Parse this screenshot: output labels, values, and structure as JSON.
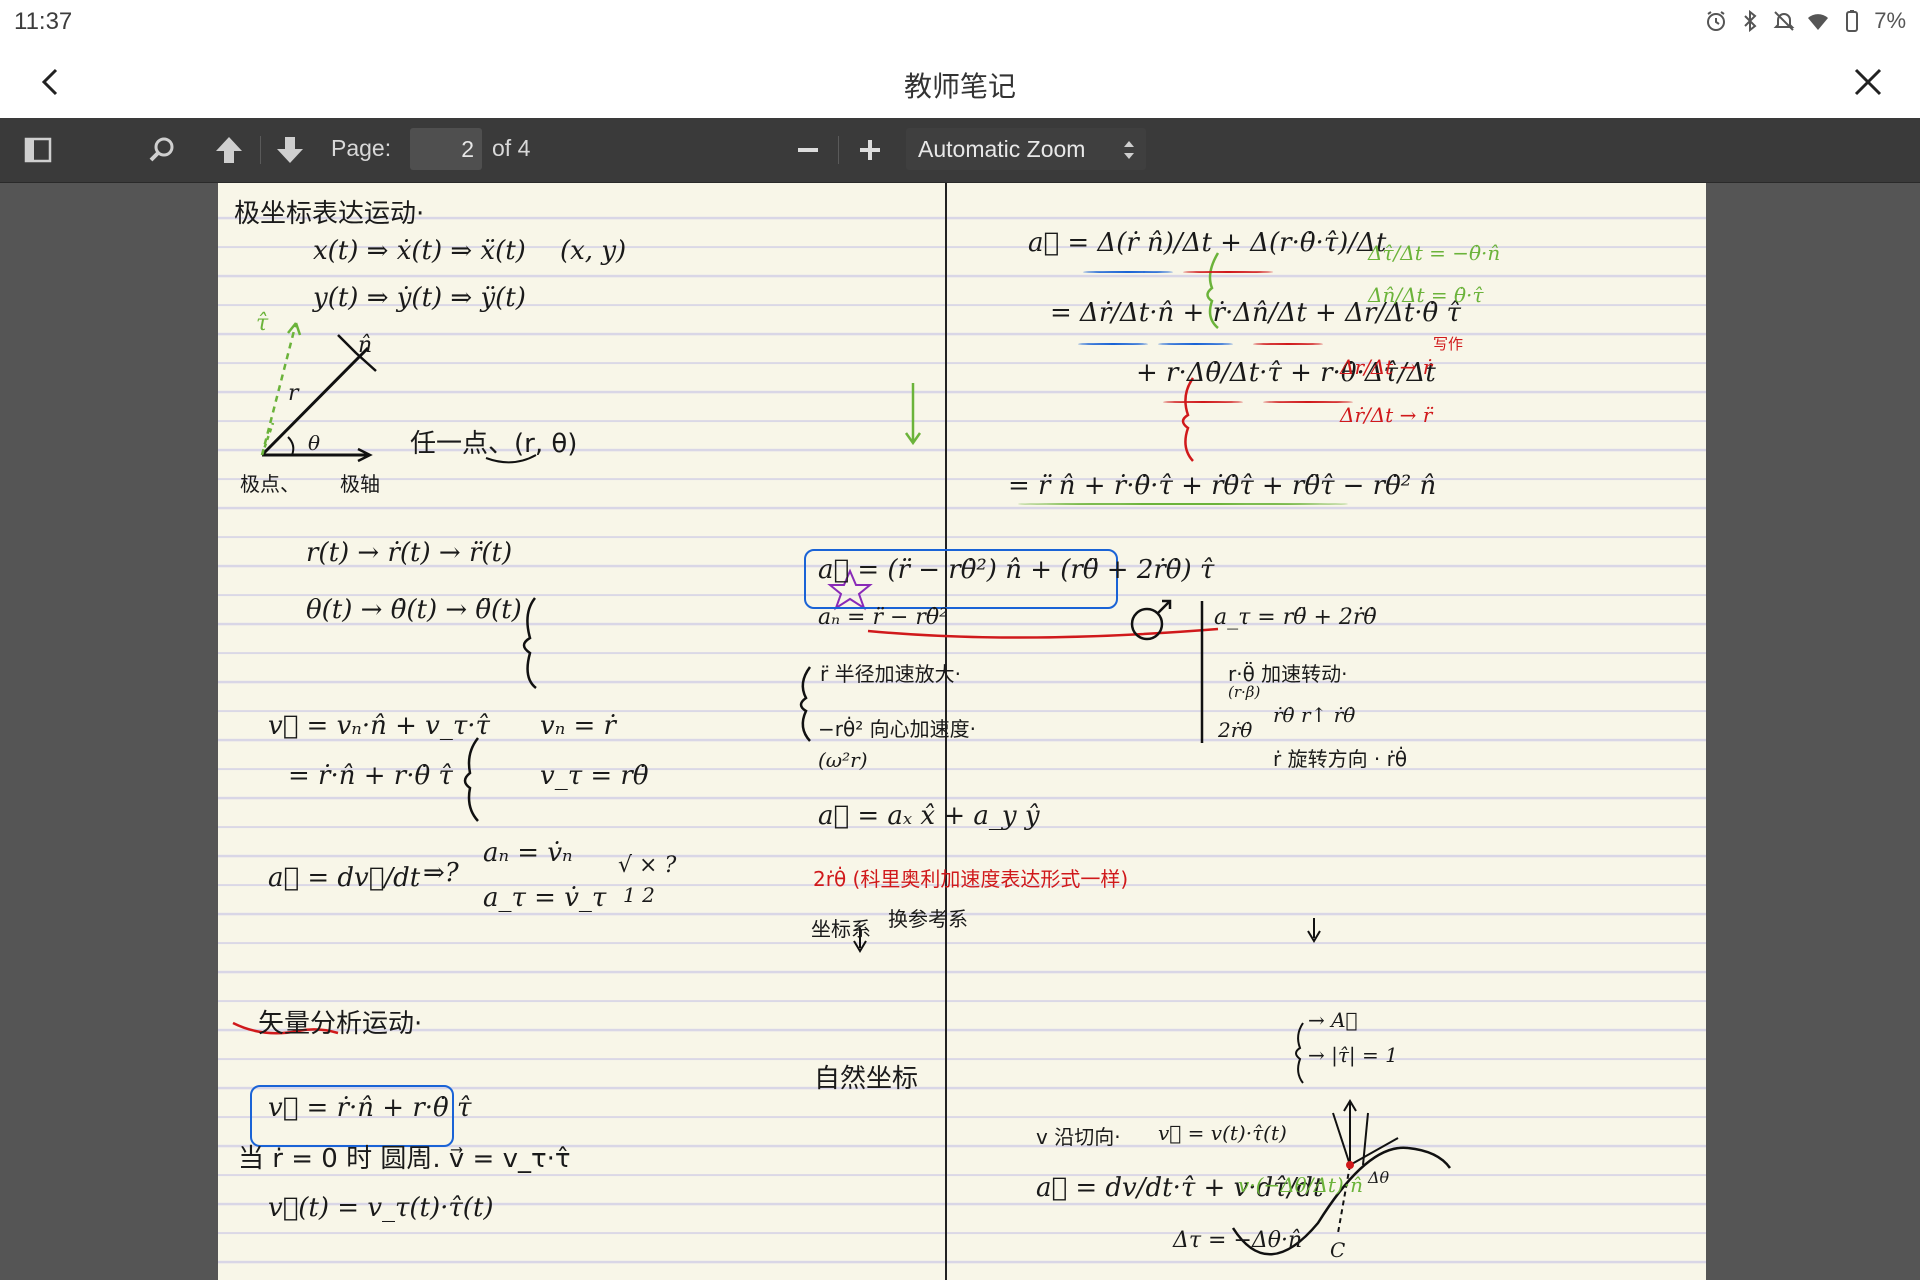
{
  "status_bar": {
    "time": "11:37",
    "battery_percent": "7%",
    "icons": [
      "alarm-icon",
      "bluetooth-icon",
      "mute-icon",
      "wifi-icon",
      "battery-icon"
    ]
  },
  "header": {
    "title": "教师笔记",
    "back_icon": "chevron-left-icon",
    "close_icon": "close-icon"
  },
  "toolbar": {
    "page_label": "Page:",
    "page_number": "2",
    "page_of": "of 4",
    "zoom": "Automatic Zoom",
    "icons": [
      "sidebar-toggle-icon",
      "search-icon",
      "previous-page-icon",
      "next-page-icon",
      "zoom-out-icon",
      "zoom-in-icon"
    ]
  },
  "notes": {
    "left": {
      "title": "极坐标表达运动·",
      "l1": "x(t) ⇒ ẋ(t) ⇒ ẍ(t)",
      "l1b": "(x, y)",
      "l2": "y(t) ⇒ ẏ(t) ⇒ ÿ(t)",
      "diag_tau": "τ̂",
      "diag_n": "n̂",
      "diag_r": "r",
      "diag_theta": "θ",
      "diag_origin": "极点、",
      "diag_axis": "极轴",
      "any_point": "任一点、(r, θ)",
      "r_chain": "r(t) → ṙ(t) → r̈(t)",
      "theta_chain": "θ(t) → θ̇(t) → θ̈(t)",
      "v1": "v⃗ = vₙ·n̂ + v_τ·τ̂",
      "v2": "= ṙ·n̂ + r·θ̇ τ̂",
      "vn": "vₙ = ṙ",
      "vt": "v_τ = rθ̇",
      "a1": "a⃗ = dv⃗/dt",
      "a_imp": "⇒?",
      "an": "aₙ = v̇ₙ",
      "at": "a_τ = v̇_τ",
      "check": "√   ×   ?",
      "check_sub": "1      2",
      "vector_title": "矢量分析运动·",
      "boxed_v": "v⃗ = ṙ·n̂ + r·θ̇ τ̂",
      "circular": "当 ṙ = 0 时   圆周.   v⃗ = v_τ·τ̂",
      "vt_line": "v⃗(t) = v_τ(t)·τ̂(t)"
    },
    "right": {
      "a_def": "a⃗ = Δ(ṙ n̂)/Δt + Δ(r·θ̇·τ̂)/Δt",
      "a_exp1": "= Δṙ/Δt·n̂ + ṙ·Δn̂/Δt + Δr/Δt·θ̇ τ̂",
      "a_exp2": "+ r·Δθ̇/Δt·τ̂ + r·θ̇·Δτ̂/Δt",
      "green_rule1": "Δτ̂/Δt = −θ̇·n̂",
      "green_rule2": "Δn̂/Δt = θ̇·τ̂",
      "red_note": "写作",
      "red_rule1": "Δr/Δt → ṙ",
      "red_rule2": "Δṙ/Δt → r̈",
      "a_sum": "= r̈ n̂ + ṙ·θ̇·τ̂ + ṙθ̇τ̂ + rθ̈τ̂ − rθ̇² n̂",
      "a_boxed": "a⃗ = (r̈ − rθ̇²) n̂ + (rθ̈ + 2ṙθ̇) τ̂",
      "an_def": "aₙ = r̈ − rθ̇²",
      "at_def": "a_τ = rθ̈ + 2ṙθ̇",
      "r_dd": "r̈   半径加速放大·",
      "r_theta2": "−rθ̇²   向心加速度·",
      "w2r": "(ω²r)",
      "r_theta_dd": "r·θ̈   加速转动·",
      "r_beta": "(r·β)",
      "two_rtheta": "2ṙθ̇",
      "rtheta_a": "ṙθ̇   r↑   ṙθ̇",
      "rtheta_b": "ṙ 旋转方向 · ṙθ̇",
      "a_cart": "a⃗ = aₓ x̂ + a_y ŷ",
      "coriolis": "2ṙθ̇ (科里奥利加速度表达形式一样)",
      "coord": "坐标系",
      "change": "换参考系",
      "A_vec": "→ A⃗",
      "tau_unit": "→ |τ̂| = 1",
      "natural": "自然坐标",
      "v_tangent": "v 沿切向·",
      "v_tau": "v⃗ = v(t)·τ̂(t)",
      "a_natural": "a⃗ = dv/dt·τ̂ + v·dτ̂/dt",
      "green_v": "v·(−Δθ/Δt)·n̂",
      "delta_tau": "Δτ = −Δθ·n̂",
      "curve_c": "C",
      "curve_dtheta": "Δθ"
    }
  },
  "colors": {
    "toolbar_bg": "#3a3a3a",
    "viewer_bg": "#555555",
    "paper": "#f8f6e8",
    "ink": "#1a1a1a",
    "red_ink": "#d0191b",
    "blue_ink": "#1a63d6",
    "green_ink": "#6bb33a",
    "purple_ink": "#8a2bb8"
  }
}
